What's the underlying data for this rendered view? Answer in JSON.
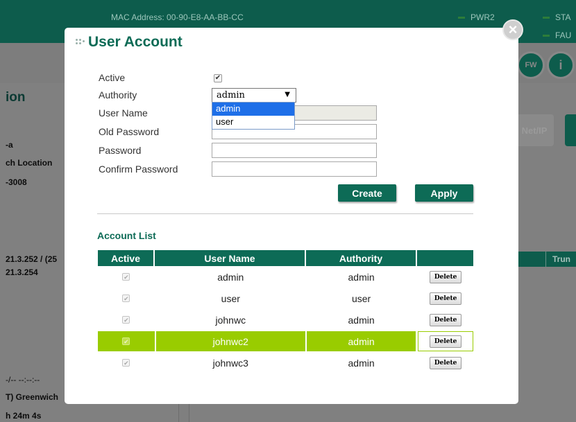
{
  "background": {
    "mac_address": "MAC Address:  00-90-E8-AA-BB-CC",
    "pwr2": "PWR2",
    "sta": "STA",
    "fau": "FAU",
    "section_title": "ion",
    "left_texts": [
      "-a",
      "ch Location",
      "-3008",
      "21.3.252 / (25",
      "21.3.254",
      "-/-- --:--:--",
      "T) Greenwich",
      "h 24m 4s"
    ],
    "net_ip": "Net/IP",
    "table_col": "Trun",
    "icon_fw": "FW",
    "icon_info": "i"
  },
  "modal": {
    "title": "User Account",
    "close_icon": "×",
    "form": {
      "active_label": "Active",
      "active_checked": true,
      "authority_label": "Authority",
      "authority_value": "admin",
      "authority_options": [
        "admin",
        "user"
      ],
      "username_label": "User Name",
      "old_password_label": "Old Password",
      "password_label": "Password",
      "confirm_password_label": "Confirm Password"
    },
    "buttons": {
      "create": "Create",
      "apply": "Apply"
    },
    "account_list": {
      "title": "Account List",
      "headers": [
        "Active",
        "User Name",
        "Authority",
        ""
      ],
      "delete_label": "Delete",
      "rows": [
        {
          "active": true,
          "username": "admin",
          "authority": "admin",
          "highlighted": false
        },
        {
          "active": true,
          "username": "user",
          "authority": "user",
          "highlighted": false
        },
        {
          "active": true,
          "username": "johnwc",
          "authority": "admin",
          "highlighted": false
        },
        {
          "active": true,
          "username": "johnwc2",
          "authority": "admin",
          "highlighted": true
        },
        {
          "active": true,
          "username": "johnwc3",
          "authority": "admin",
          "highlighted": false
        }
      ]
    }
  },
  "colors": {
    "brand_green": "#0d6b56",
    "highlight_green": "#99cc00",
    "dropdown_selected": "#1e6fe8"
  }
}
